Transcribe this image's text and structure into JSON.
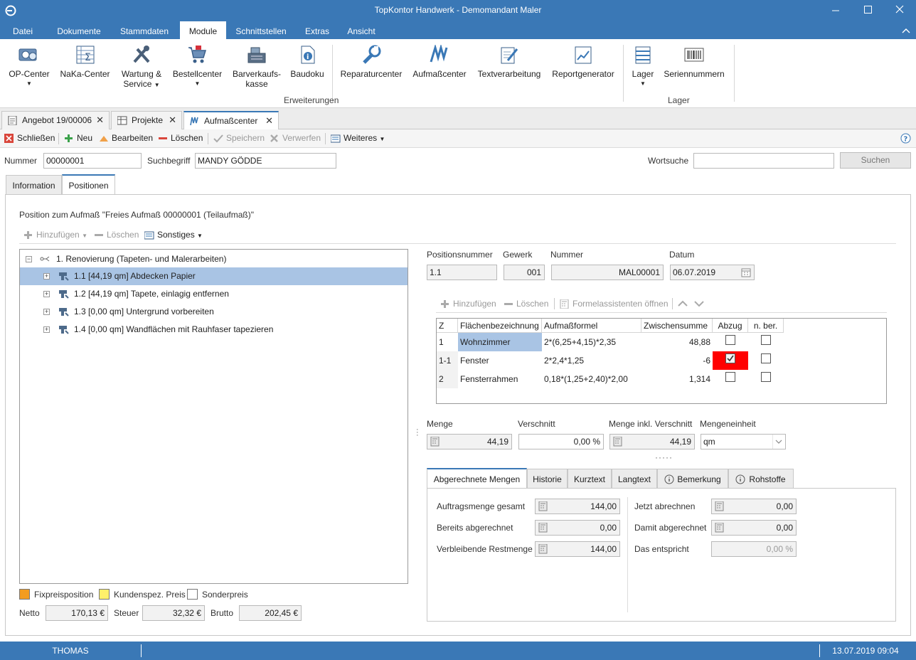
{
  "window": {
    "title": "TopKontor Handwerk - Demomandant Maler"
  },
  "menu": {
    "items": [
      "Datei",
      "Dokumente",
      "Stammdaten",
      "Module",
      "Schnittstellen",
      "Extras",
      "Ansicht"
    ],
    "active": "Module"
  },
  "ribbon": {
    "op_center": "OP-Center",
    "naka_center": "NaKa-Center",
    "wartung_line1": "Wartung &",
    "wartung_line2": "Service",
    "bestellcenter": "Bestellcenter",
    "barverkauf_line1": "Barverkaufs-",
    "barverkauf_line2": "kasse",
    "baudoku": "Baudoku",
    "reparaturcenter": "Reparaturcenter",
    "aufmasscenter": "Aufmaßcenter",
    "textverarbeitung": "Textverarbeitung",
    "reportgenerator": "Reportgenerator",
    "erweiterungen": "Erweiterungen",
    "lager": "Lager",
    "seriennummern": "Seriennummern",
    "lager_group": "Lager"
  },
  "doc_tabs": [
    "Angebot 19/00006",
    "Projekte",
    "Aufmaßcenter"
  ],
  "toolbar": {
    "schliessen": "Schließen",
    "neu": "Neu",
    "bearbeiten": "Bearbeiten",
    "loeschen": "Löschen",
    "speichern": "Speichern",
    "verwerfen": "Verwerfen",
    "weiteres": "Weiteres"
  },
  "search": {
    "nummer_label": "Nummer",
    "nummer_value": "00000001",
    "suchbegriff_label": "Suchbegriff",
    "suchbegriff_value": "MANDY GÖDDE",
    "wortsuche_label": "Wortsuche",
    "wortsuche_value": "",
    "suchen": "Suchen"
  },
  "panel_tabs": [
    "Information",
    "Positionen"
  ],
  "positions": {
    "heading": "Position zum Aufmaß \"Freies Aufmaß 00000001 (Teilaufmaß)\"",
    "hinzufuegen": "Hinzufügen",
    "loeschen": "Löschen",
    "sonstiges": "Sonstiges"
  },
  "tree": {
    "root": "1. Renovierung (Tapeten- und Malerarbeiten)",
    "items": [
      "1.1  [44,19 qm] Abdecken Papier",
      "1.2  [44,19 qm] Tapete, einlagig entfernen",
      "1.3  [0,00 qm] Untergrund vorbereiten",
      "1.4  [0,00 qm] Wandflächen mit Rauhfaser tapezieren"
    ]
  },
  "legend": {
    "fixpreis": "Fixpreisposition",
    "kundenspez": "Kundenspez. Preis",
    "sonderpreis": "Sonderpreis",
    "fixpreis_color": "#f39c1f",
    "kundenspez_color": "#fff06a"
  },
  "totals": {
    "netto_label": "Netto",
    "netto": "170,13 €",
    "steuer_label": "Steuer",
    "steuer": "32,32 €",
    "brutto_label": "Brutto",
    "brutto": "202,45 €"
  },
  "detail": {
    "positionsnummer_label": "Positionsnummer",
    "positionsnummer": "1.1",
    "gewerk_label": "Gewerk",
    "gewerk": "001",
    "nummer_label": "Nummer",
    "nummer": "MAL00001",
    "datum_label": "Datum",
    "datum": "06.07.2019"
  },
  "formula_toolbar": {
    "hinzufuegen": "Hinzufügen",
    "loeschen": "Löschen",
    "formelassistent": "Formelassistenten öffnen"
  },
  "grid": {
    "headers": [
      "Z",
      "Flächenbezeichnung",
      "Aufmaßformel",
      "Zwischensumme",
      "Abzug",
      "n. ber."
    ],
    "rows": [
      {
        "z": "1",
        "flaeche": "Wohnzimmer",
        "formel": "2*(6,25+4,15)*2,35",
        "summe": "48,88",
        "abzug": false,
        "nber": false
      },
      {
        "z": "1-1",
        "flaeche": "Fenster",
        "formel": "2*2,4*1,25",
        "summe": "-6",
        "abzug": true,
        "nber": false
      },
      {
        "z": "2",
        "flaeche": "Fensterrahmen",
        "formel": "0,18*(1,25+2,40)*2,00",
        "summe": "1,314",
        "abzug": false,
        "nber": false
      }
    ],
    "highlight_color": "#ff0000"
  },
  "menge": {
    "menge_label": "Menge",
    "menge": "44,19",
    "verschnitt_label": "Verschnitt",
    "verschnitt": "0,00 %",
    "menge_inkl_label": "Menge inkl. Verschnitt",
    "menge_inkl": "44,19",
    "einheit_label": "Mengeneinheit",
    "einheit": "qm"
  },
  "info_tabs": [
    "Abgerechnete Mengen",
    "Historie",
    "Kurztext",
    "Langtext",
    "Bemerkung",
    "Rohstoffe"
  ],
  "abgerechnet": {
    "auftragsmenge_label": "Auftragsmenge gesamt",
    "auftragsmenge": "144,00",
    "bereits_label": "Bereits abgerechnet",
    "bereits": "0,00",
    "rest_label": "Verbleibende Restmenge",
    "rest": "144,00",
    "jetzt_label": "Jetzt abrechnen",
    "jetzt": "0,00",
    "damit_label": "Damit abgerechnet",
    "damit": "0,00",
    "entspricht_label": "Das entspricht",
    "entspricht": "0,00 %"
  },
  "status": {
    "user": "THOMAS",
    "datetime": "13.07.2019 09:04"
  }
}
